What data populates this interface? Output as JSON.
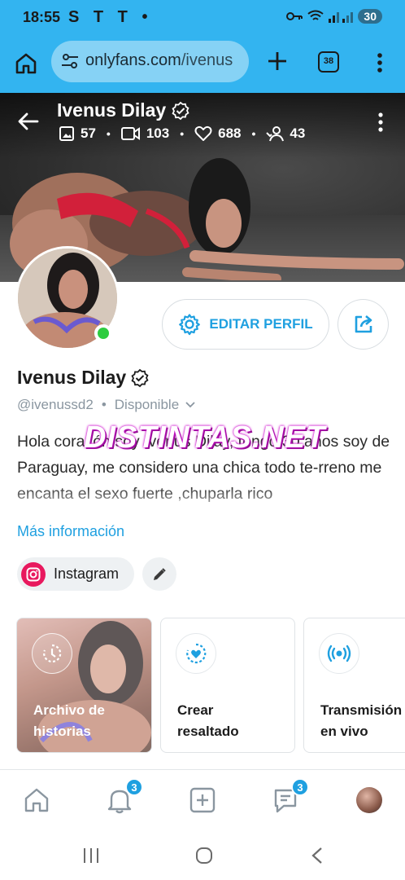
{
  "status_bar": {
    "time": "18:55",
    "notifications": "S T T •",
    "battery": "30"
  },
  "browser": {
    "url_host": "onlyfans.com",
    "url_path": "/ivenus",
    "tabs_count": "38"
  },
  "profile": {
    "name": "Ivenus Dilay",
    "stats": {
      "photos": "57",
      "videos": "103",
      "likes": "688",
      "fans": "43"
    },
    "handle": "@ivenussd2",
    "status": "Disponible",
    "bio": "Hola corazón soy Ivenus Dilay, tengo 30 años soy de Paraguay, me considero una chica todo te-rreno me encanta el sexo fuerte ,chuparla rico",
    "more_info": "Más información",
    "edit_profile": "EDITAR PERFIL",
    "social_label": "Instagram"
  },
  "watermark": "DISTINTAS.NET",
  "cards": {
    "archive": {
      "label_line1": "Archivo de",
      "label_line2": "historias"
    },
    "highlight": {
      "label_line1": "Crear",
      "label_line2": "resaltado"
    },
    "live": {
      "label_line1": "Transmisión",
      "label_line2": "en vivo"
    }
  },
  "bottom_nav": {
    "notifications_badge": "3",
    "messages_badge": "3"
  },
  "colors": {
    "accent": "#1fa0e0",
    "browser_bar": "#33b4f0",
    "online": "#2ecc40",
    "instagram": "#e8195e"
  },
  "icons": [
    "home-icon",
    "tune-icon",
    "plus-icon",
    "more-vert-icon",
    "arrow-back-icon",
    "verified-icon",
    "image-icon",
    "video-icon",
    "heart-icon",
    "fans-icon",
    "gear-icon",
    "share-icon",
    "chevron-down-icon",
    "instagram-icon",
    "pencil-icon",
    "history-icon",
    "heart-circle-icon",
    "broadcast-icon",
    "bell-icon",
    "add-post-icon",
    "chat-icon"
  ]
}
